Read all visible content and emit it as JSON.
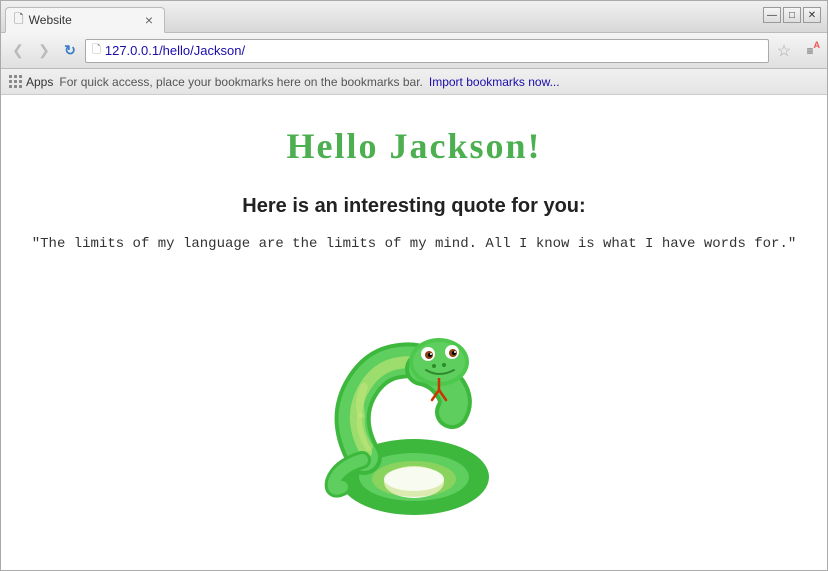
{
  "window": {
    "title": "Website",
    "controls": {
      "minimize": "—",
      "maximize": "□",
      "close": "✕"
    }
  },
  "tab": {
    "icon": "📄",
    "label": "Website",
    "close": "×"
  },
  "nav": {
    "back": "‹",
    "forward": "›",
    "refresh": "↻",
    "url": "127.0.0.1/hello/Jackson/",
    "star": "☆",
    "menu": "≡",
    "menu_badge": "A"
  },
  "bookmarks": {
    "apps_label": "Apps",
    "hint_text": "For quick access, place your bookmarks here on the bookmarks bar.",
    "import_label": "Import bookmarks now..."
  },
  "page": {
    "heading": "Hello Jackson!",
    "quote_intro": "Here is an interesting quote for you:",
    "quote": "\"The limits of my language are the limits of my mind.  All I know is what I have words for.\""
  }
}
